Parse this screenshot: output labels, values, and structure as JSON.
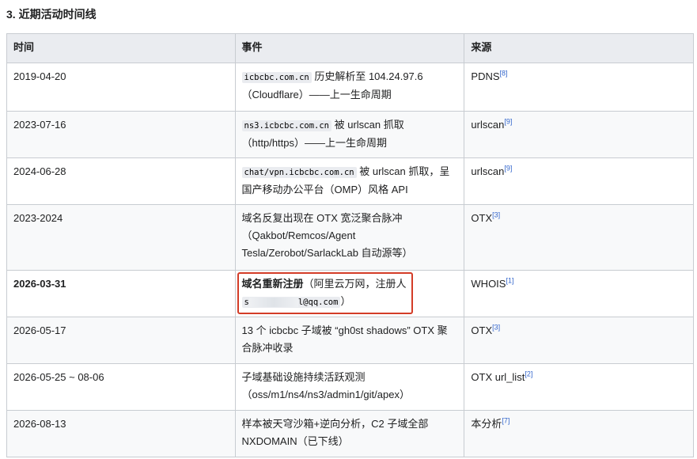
{
  "heading": "3. 近期活动时间线",
  "columns": [
    "时间",
    "事件",
    "来源"
  ],
  "rows": [
    {
      "time": "2019-04-20",
      "event_code": "icbcbc.com.cn",
      "event_text": " 历史解析至 104.24.97.6（Cloudflare）——上一生命周期",
      "source": "PDNS",
      "ref": "[8]"
    },
    {
      "time": "2023-07-16",
      "event_code": "ns3.icbcbc.com.cn",
      "event_text": " 被 urlscan 抓取（http/https）——上一生命周期",
      "source": "urlscan",
      "ref": "[9]"
    },
    {
      "time": "2024-06-28",
      "event_code": "chat/vpn.icbcbc.com.cn",
      "event_text": " 被 urlscan 抓取，呈国产移动办公平台（OMP）风格 API",
      "source": "urlscan",
      "ref": "[9]"
    },
    {
      "time": "2023-2024",
      "event_text": "域名反复出现在 OTX 宽泛聚合脉冲（Qakbot/Remcos/Agent Tesla/Zerobot/SarlackLab 自动源等）",
      "source": "OTX",
      "ref": "[3]"
    },
    {
      "time": "2026-03-31",
      "event_bold": "域名重新注册",
      "event_text": "（阿里云万网，注册人",
      "event_code_prefix": "s",
      "event_code_suffix": "l@qq.com",
      "event_tail": "）",
      "source": "WHOIS",
      "ref": "[1]"
    },
    {
      "time": "2026-05-17",
      "event_text": "13 个 icbcbc 子域被 “gh0st shadows” OTX 聚合脉冲收录",
      "source": "OTX",
      "ref": "[3]"
    },
    {
      "time": "2026-05-25 ~ 08-06",
      "event_text": "子域基础设施持续活跃观测（oss/m1/ns4/ns3/admin1/git/apex）",
      "source": "OTX url_list",
      "ref": "[2]"
    },
    {
      "time": "2026-08-13",
      "event_text": "样本被天穹沙箱+逆向分析，C2 子域全部 NXDOMAIN（已下线）",
      "source": "本分析",
      "ref": "[7]"
    }
  ]
}
